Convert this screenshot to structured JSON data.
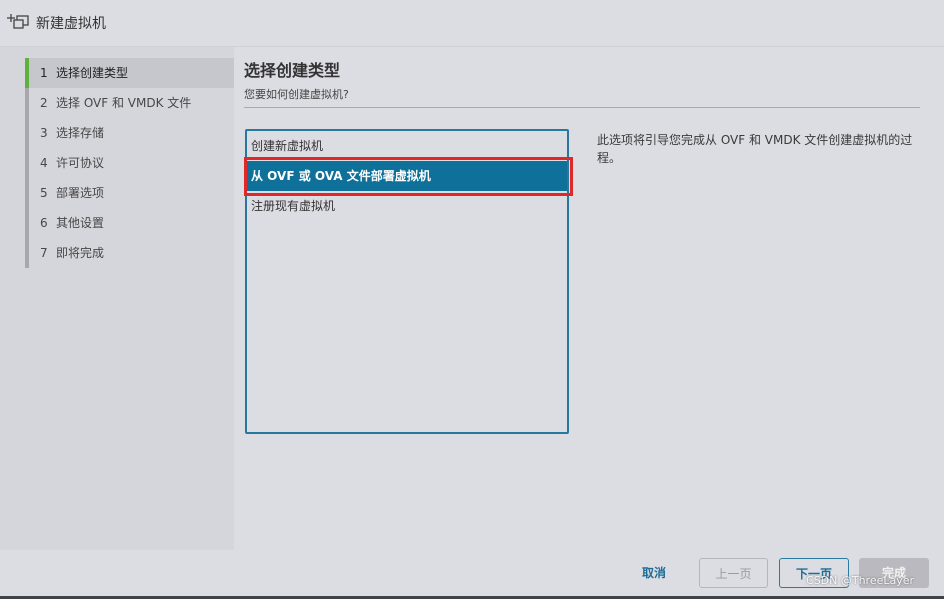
{
  "dialog": {
    "title": "新建虚拟机",
    "icon": "new-vm-icon"
  },
  "steps": [
    {
      "num": "1",
      "label": "选择创建类型",
      "active": true
    },
    {
      "num": "2",
      "label": "选择 OVF 和 VMDK 文件"
    },
    {
      "num": "3",
      "label": "选择存储"
    },
    {
      "num": "4",
      "label": "许可协议"
    },
    {
      "num": "5",
      "label": "部署选项"
    },
    {
      "num": "6",
      "label": "其他设置"
    },
    {
      "num": "7",
      "label": "即将完成"
    }
  ],
  "main": {
    "title": "选择创建类型",
    "subtitle": "您要如何创建虚拟机?",
    "options": [
      {
        "label": "创建新虚拟机"
      },
      {
        "label": "从 OVF 或 OVA 文件部署虚拟机",
        "selected": true
      },
      {
        "label": "注册现有虚拟机"
      }
    ],
    "description": "此选项将引导您完成从 OVF 和 VMDK 文件创建虚拟机的过程。"
  },
  "footer": {
    "cancel": "取消",
    "back": "上一页",
    "next": "下一页",
    "finish": "完成"
  },
  "watermark": "CSDN @ThreeLayer",
  "colors": {
    "accent": "#0f7099",
    "active_step_bar": "#5fb13d",
    "highlight": "#e02828"
  }
}
